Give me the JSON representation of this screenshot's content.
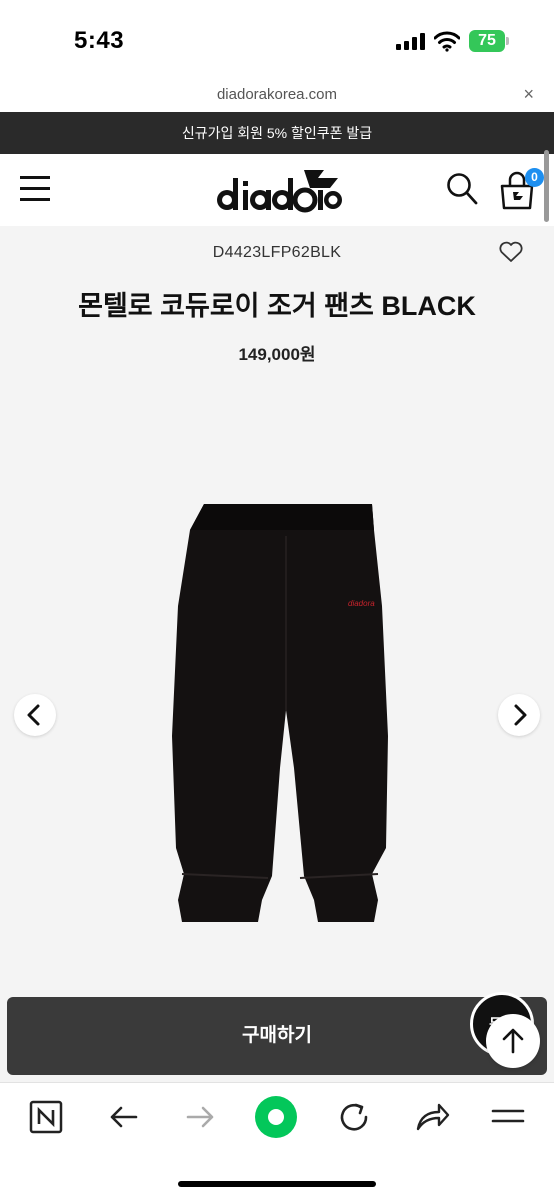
{
  "status_bar": {
    "time": "5:43",
    "battery": "75"
  },
  "browser": {
    "url": "diadorakorea.com",
    "close_label": "×"
  },
  "promo_banner": {
    "text": "신규가입 회원 5% 할인쿠폰 발급"
  },
  "header": {
    "cart_count": "0"
  },
  "product": {
    "sku": "D4423LFP62BLK",
    "title": "몬텔로 코듀로이 조거 팬츠 BLACK",
    "price": "149,000원",
    "image_brand_mark": "diadora"
  },
  "actions": {
    "buy_label": "구매하기",
    "chat_label": "문의"
  },
  "icons": {
    "menu": "hamburger-icon",
    "search": "search-icon",
    "cart": "cart-icon",
    "wishlist": "heart-icon",
    "carousel_prev": "chevron-left-icon",
    "carousel_next": "chevron-right-icon",
    "scroll_top": "arrow-up-icon",
    "browser_home": "naver-n-icon",
    "browser_back": "arrow-left-icon",
    "browser_forward": "arrow-right-icon",
    "browser_green": "green-circle-icon",
    "browser_reload": "reload-icon",
    "browser_share": "share-icon",
    "browser_menu": "menu-lines-icon"
  },
  "colors": {
    "promo_bg": "#2a2a2a",
    "cart_badge": "#1d8ff0",
    "battery": "#34c759",
    "buy_button": "#3a3a3a",
    "browser_green": "#03c75a"
  }
}
